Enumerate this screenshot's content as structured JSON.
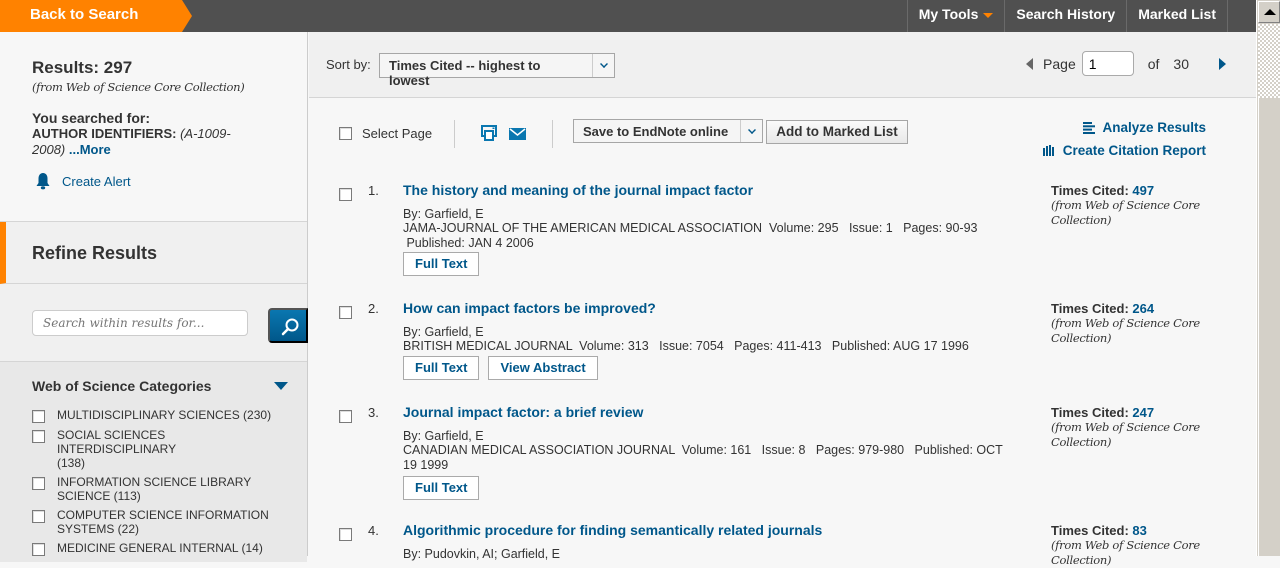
{
  "topbar": {
    "back_label": "Back to Search",
    "nav": [
      {
        "label": "My Tools",
        "has_dropdown": true
      },
      {
        "label": "Search History"
      },
      {
        "label": "Marked List"
      }
    ]
  },
  "summary": {
    "results_label": "Results: 297",
    "from_collection": "(from Web of Science Core Collection)",
    "searched_label": "You searched for:",
    "query_field": "AUTHOR IDENTIFIERS:",
    "query_value": "(A-1009-2008)",
    "more_label": "...More",
    "create_alert_label": "Create Alert"
  },
  "refine": {
    "title": "Refine Results",
    "search_placeholder": "Search within results for...",
    "categories_title": "Web of Science Categories",
    "categories": [
      {
        "label": "MULTIDISCIPLINARY SCIENCES (230)",
        "checked": false
      },
      {
        "label": "SOCIAL SCIENCES INTERDISCIPLINARY (138)",
        "checked": false
      },
      {
        "label": "INFORMATION SCIENCE LIBRARY SCIENCE (113)",
        "checked": false
      },
      {
        "label": "COMPUTER SCIENCE INFORMATION SYSTEMS (22)",
        "checked": false
      },
      {
        "label": "MEDICINE GENERAL INTERNAL (14)",
        "checked": false
      }
    ]
  },
  "sort": {
    "label": "Sort by:",
    "selected": "Times Cited -- highest to lowest"
  },
  "pager": {
    "page_label": "Page",
    "current_page": "1",
    "of_label": "of",
    "total_pages": "30"
  },
  "toolbar": {
    "select_page_label": "Select Page",
    "endnote_label": "Save to EndNote online",
    "add_marked_label": "Add to Marked List",
    "analyze_label": "Analyze Results",
    "citation_report_label": "Create Citation Report"
  },
  "colors": {
    "accent_orange": "#ff8200",
    "link_blue": "#00578a",
    "topbar_gray": "#505050"
  },
  "records": [
    {
      "number": "1.",
      "title": "The history and meaning of the journal impact factor",
      "authors": "By: Garfield, E",
      "source": "JAMA-JOURNAL OF THE AMERICAN MEDICAL ASSOCIATION  Volume: 295   Issue: 1   Pages: 90-93",
      "published": " Published: JAN 4 2006",
      "buttons": [
        "Full Text"
      ],
      "cited_label": "Times Cited: ",
      "cited_value": "497",
      "cited_from": "(from Web of Science Core Collection)"
    },
    {
      "number": "2.",
      "title": "How can impact factors be improved?",
      "authors": "By: Garfield, E",
      "source": "BRITISH MEDICAL JOURNAL  Volume: 313   Issue: 7054   Pages: 411-413   Published: AUG 17 1996",
      "published": "",
      "buttons": [
        "Full Text",
        "View Abstract"
      ],
      "cited_label": "Times Cited: ",
      "cited_value": "264",
      "cited_from": "(from Web of Science Core Collection)"
    },
    {
      "number": "3.",
      "title": "Journal impact factor: a brief review",
      "authors": "By: Garfield, E",
      "source": "CANADIAN MEDICAL ASSOCIATION JOURNAL  Volume: 161   Issue: 8   Pages: 979-980   Published: OCT 19 1999",
      "published": "",
      "buttons": [
        "Full Text"
      ],
      "cited_label": "Times Cited: ",
      "cited_value": "247",
      "cited_from": "(from Web of Science Core Collection)"
    },
    {
      "number": "4.",
      "title": "Algorithmic procedure for finding semantically related journals",
      "authors": "By: Pudovkin, AI; Garfield, E",
      "source": "",
      "published": "",
      "buttons": [],
      "cited_label": "Times Cited: ",
      "cited_value": "83",
      "cited_from": "(from Web of Science Core Collection)"
    }
  ]
}
